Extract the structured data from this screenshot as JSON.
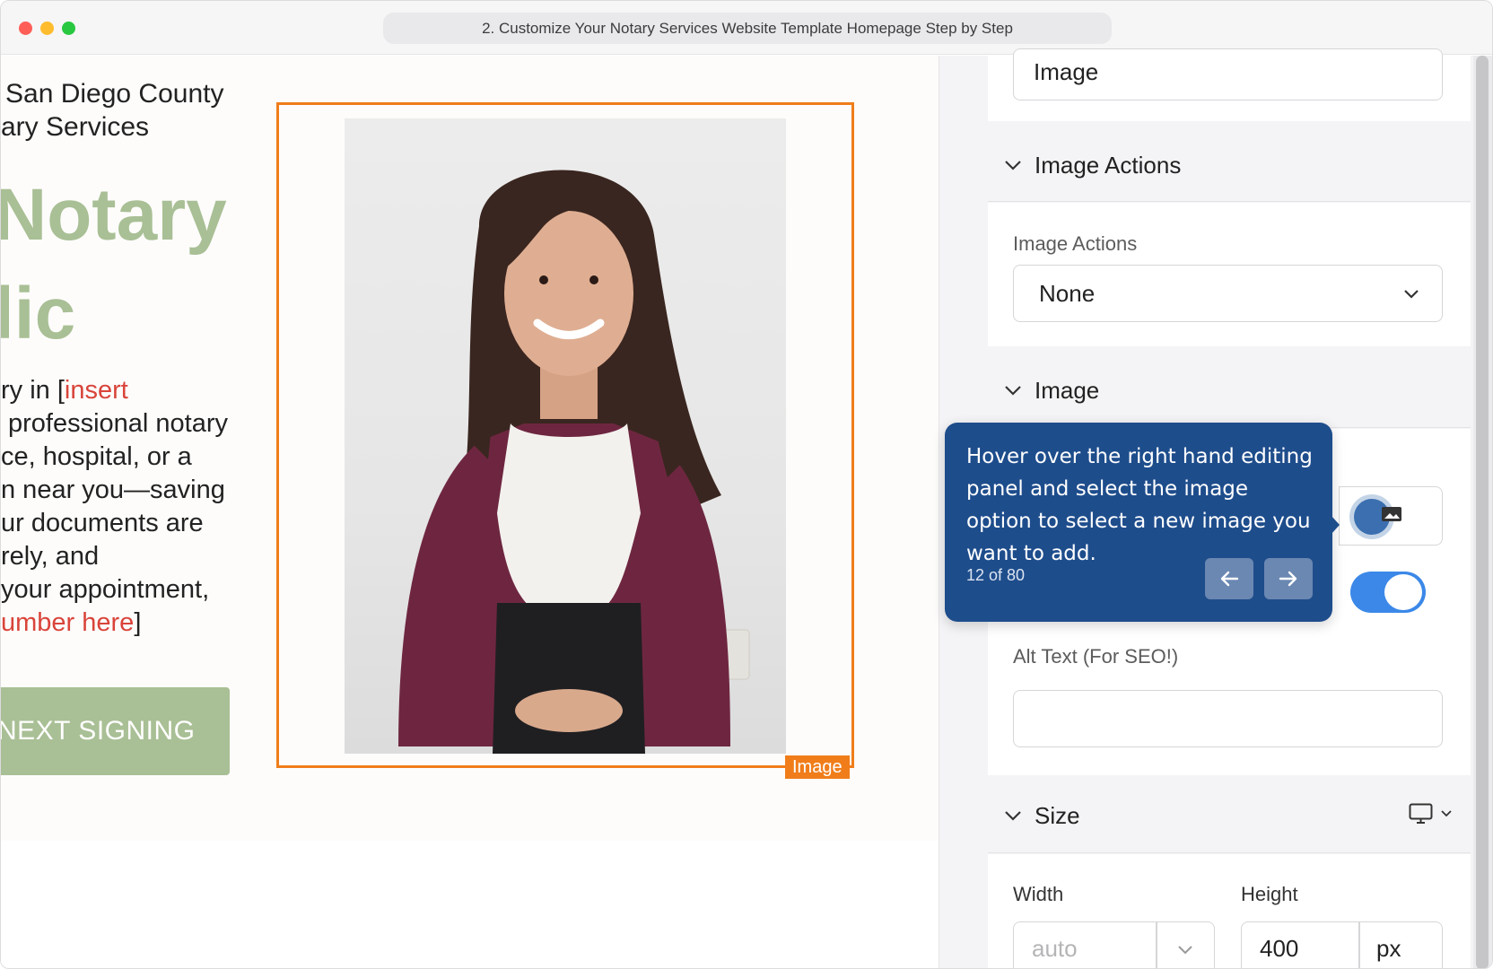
{
  "window": {
    "title": "2. Customize Your Notary Services Website Template Homepage Step by Step"
  },
  "canvas": {
    "subtitle_line1": "San Diego County",
    "subtitle_line2": "ary Services",
    "big_line1": "Notary",
    "big_line2": "lic",
    "para": {
      "l1a": "ry in [",
      "l1b": "insert",
      "l2": "professional notary",
      "l3": "ce, hospital, or a",
      "l4": "n near you—saving",
      "l5": "ur documents are",
      "l6": "rely, and",
      "l7": "your appointment,",
      "l8a": "umber here",
      "l8b": "]"
    },
    "cta_label": "NEXT SIGNING",
    "image_frame_label": "Image"
  },
  "panel": {
    "type_value": "Image",
    "image_actions_header": "Image Actions",
    "image_actions_label": "Image Actions",
    "image_actions_value": "None",
    "image_header": "Image",
    "alt_text_label": "Alt Text (For SEO!)",
    "alt_text_value": "",
    "size_header": "Size",
    "width_label": "Width",
    "width_placeholder": "auto",
    "height_label": "Height",
    "height_value": "400",
    "height_unit": "px"
  },
  "tooltip": {
    "text": "Hover over the right hand editing panel and select the image option to select a new image you want to add.",
    "step": "12 of 80"
  },
  "colors": {
    "accent_green": "#a9bf95",
    "frame_orange": "#f07d1a",
    "tooltip_blue": "#1e4d8c",
    "toggle_blue": "#3b88e8",
    "text_red": "#d9443a"
  }
}
